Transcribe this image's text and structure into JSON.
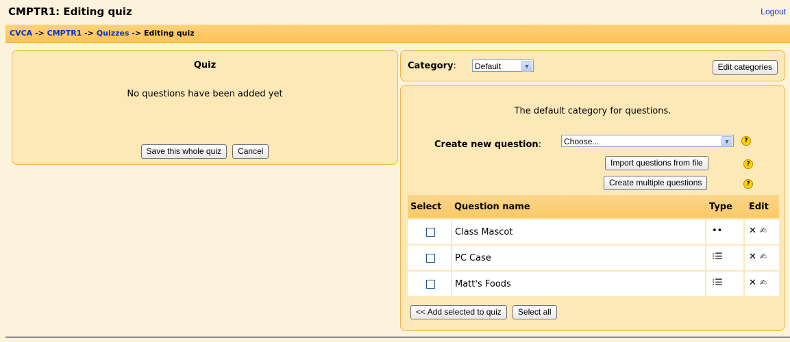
{
  "header": {
    "title": "CMPTR1: Editing quiz",
    "logout": "Logout"
  },
  "breadcrumb": {
    "items": [
      "CVCA",
      "CMPTR1",
      "Quizzes"
    ],
    "separator": " -> ",
    "current": "Editing quiz"
  },
  "quiz": {
    "heading": "Quiz",
    "empty_message": "No questions have been added yet",
    "save_label": "Save this whole quiz",
    "cancel_label": "Cancel"
  },
  "category": {
    "label": "Category",
    "colon": ":",
    "selected": "Default",
    "edit_categories_label": "Edit categories"
  },
  "questions": {
    "category_info": "The default category for questions.",
    "create_label": "Create new question",
    "create_colon": ":",
    "create_selected": "Choose...",
    "import_label": "Import questions from file",
    "multiple_label": "Create multiple questions",
    "help_glyph": "?",
    "columns": {
      "select": "Select",
      "name": "Question name",
      "type": "Type",
      "edit": "Edit"
    },
    "rows": [
      {
        "name": "Class Mascot",
        "type_icon": "shortanswer-icon",
        "type_glyph": "••",
        "checked": false
      },
      {
        "name": "PC Case",
        "type_icon": "multichoice-icon",
        "type_glyph": "⁝☰",
        "checked": false
      },
      {
        "name": "Matt's Foods",
        "type_icon": "multichoice-icon",
        "type_glyph": "⁝☰",
        "checked": false
      }
    ],
    "delete_glyph": "✕",
    "edit_glyph": "✍",
    "add_selected_label": "<< Add selected to quiz",
    "select_all_label": "Select all"
  },
  "colors": {
    "background": "#fdf3dc",
    "panel": "#fde8b8",
    "panel_border": "#f0b54a",
    "navbar": "#fbc256",
    "link": "#0033cc"
  }
}
